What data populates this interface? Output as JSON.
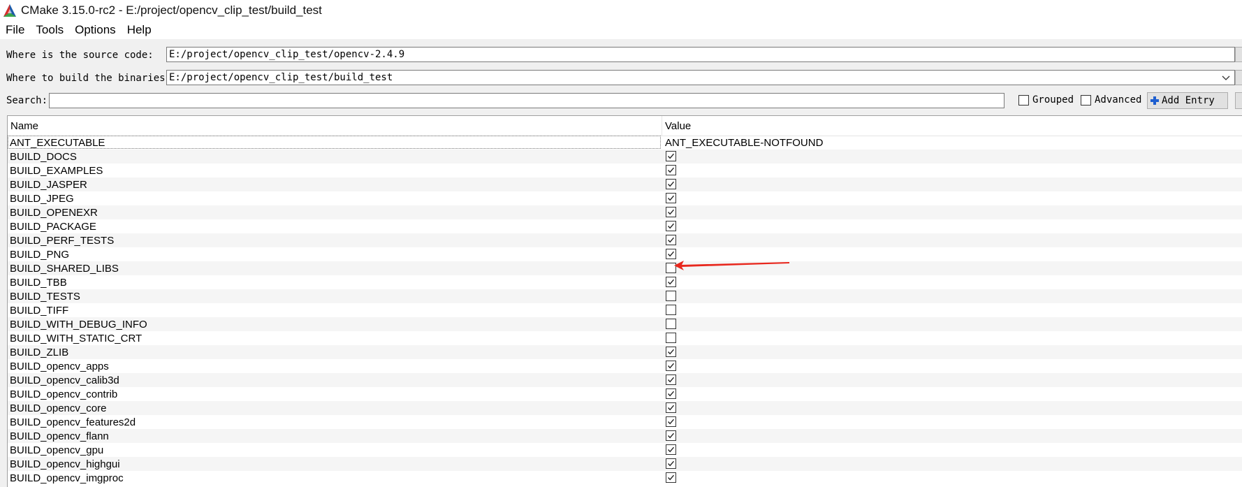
{
  "window": {
    "title": "CMake 3.15.0-rc2 - E:/project/opencv_clip_test/build_test"
  },
  "menu": [
    {
      "label": "File"
    },
    {
      "label": "Tools"
    },
    {
      "label": "Options"
    },
    {
      "label": "Help"
    }
  ],
  "source": {
    "label": "Where is the source code:",
    "value": "E:/project/opencv_clip_test/opencv-2.4.9"
  },
  "binaries": {
    "label": "Where to build the binaries:",
    "value": "E:/project/opencv_clip_test/build_test"
  },
  "search": {
    "label": "Search:",
    "value": ""
  },
  "options": {
    "grouped_label": "Grouped",
    "grouped_checked": false,
    "advanced_label": "Advanced",
    "advanced_checked": false,
    "add_entry_label": "Add Entry"
  },
  "table": {
    "columns": [
      "Name",
      "Value"
    ],
    "rows": [
      {
        "name": "ANT_EXECUTABLE",
        "type": "text",
        "value": "ANT_EXECUTABLE-NOTFOUND",
        "selected": true
      },
      {
        "name": "BUILD_DOCS",
        "type": "bool",
        "checked": true
      },
      {
        "name": "BUILD_EXAMPLES",
        "type": "bool",
        "checked": true
      },
      {
        "name": "BUILD_JASPER",
        "type": "bool",
        "checked": true
      },
      {
        "name": "BUILD_JPEG",
        "type": "bool",
        "checked": true
      },
      {
        "name": "BUILD_OPENEXR",
        "type": "bool",
        "checked": true
      },
      {
        "name": "BUILD_PACKAGE",
        "type": "bool",
        "checked": true
      },
      {
        "name": "BUILD_PERF_TESTS",
        "type": "bool",
        "checked": true
      },
      {
        "name": "BUILD_PNG",
        "type": "bool",
        "checked": true
      },
      {
        "name": "BUILD_SHARED_LIBS",
        "type": "bool",
        "checked": false
      },
      {
        "name": "BUILD_TBB",
        "type": "bool",
        "checked": true
      },
      {
        "name": "BUILD_TESTS",
        "type": "bool",
        "checked": false
      },
      {
        "name": "BUILD_TIFF",
        "type": "bool",
        "checked": false
      },
      {
        "name": "BUILD_WITH_DEBUG_INFO",
        "type": "bool",
        "checked": false
      },
      {
        "name": "BUILD_WITH_STATIC_CRT",
        "type": "bool",
        "checked": false
      },
      {
        "name": "BUILD_ZLIB",
        "type": "bool",
        "checked": true
      },
      {
        "name": "BUILD_opencv_apps",
        "type": "bool",
        "checked": true
      },
      {
        "name": "BUILD_opencv_calib3d",
        "type": "bool",
        "checked": true
      },
      {
        "name": "BUILD_opencv_contrib",
        "type": "bool",
        "checked": true
      },
      {
        "name": "BUILD_opencv_core",
        "type": "bool",
        "checked": true
      },
      {
        "name": "BUILD_opencv_features2d",
        "type": "bool",
        "checked": true
      },
      {
        "name": "BUILD_opencv_flann",
        "type": "bool",
        "checked": true
      },
      {
        "name": "BUILD_opencv_gpu",
        "type": "bool",
        "checked": true
      },
      {
        "name": "BUILD_opencv_highgui",
        "type": "bool",
        "checked": true
      },
      {
        "name": "BUILD_opencv_imgproc",
        "type": "bool",
        "checked": true
      }
    ]
  },
  "colors": {
    "annotation_arrow": "#e8281e",
    "add_entry_icon": "#1f5fd0"
  }
}
